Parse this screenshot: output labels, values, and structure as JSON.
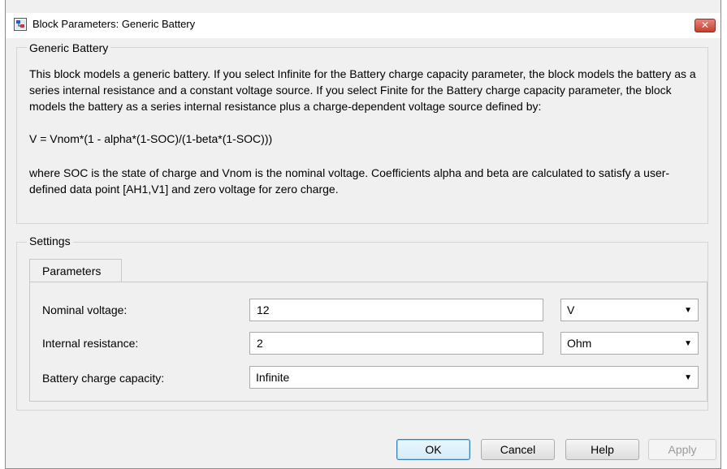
{
  "window": {
    "title": "Block Parameters: Generic Battery",
    "close_symbol": "✕",
    "icon": "simulink-block-icon"
  },
  "description": {
    "group_label": "Generic Battery",
    "paragraph1": "This block models a generic battery. If you select Infinite for the Battery charge capacity parameter, the block models the battery as a series internal resistance and a constant voltage source. If you select Finite for the Battery charge capacity parameter, the block models the battery as a series internal resistance plus a charge-dependent voltage source defined by:",
    "formula": "V = Vnom*(1 - alpha*(1-SOC)/(1-beta*(1-SOC)))",
    "paragraph2": "where SOC is the state of charge and Vnom is the nominal voltage. Coefficients alpha and beta are calculated to satisfy a user-defined data point [AH1,V1] and zero voltage for zero charge."
  },
  "settings": {
    "group_label": "Settings",
    "tab_label": "Parameters",
    "fields": [
      {
        "label": "Nominal voltage:",
        "value": "12",
        "unit": "V"
      },
      {
        "label": "Internal resistance:",
        "value": "2",
        "unit": "Ohm"
      },
      {
        "label": "Battery charge capacity:",
        "value": "Infinite"
      }
    ],
    "dropdown_arrow": "▼"
  },
  "buttons": {
    "ok": "OK",
    "cancel": "Cancel",
    "help": "Help",
    "apply": "Apply"
  },
  "colors": {
    "close_button": "#c7402f",
    "default_button_border": "#3c7fb1"
  }
}
